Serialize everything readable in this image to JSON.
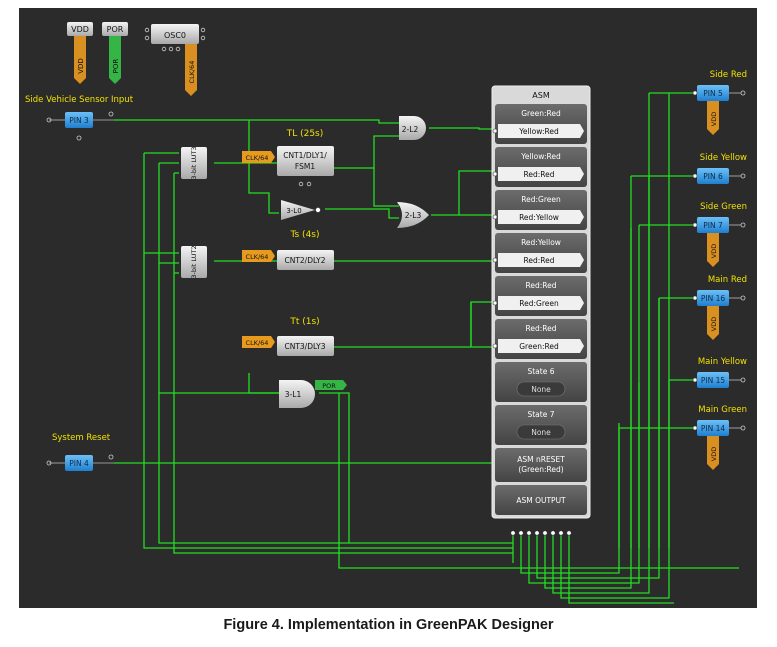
{
  "caption": "Figure 4. Implementation in GreenPAK Designer",
  "colors": {
    "background": "#2b2b2b",
    "wire": "#22dd22",
    "label_yellow": "#f2e200",
    "pin_blue": "#3aa0e6",
    "clk_orange": "#e89a1e",
    "vdd_tag": "#d99020",
    "por_tag": "#35b545"
  },
  "top_blocks": {
    "vdd": "VDD",
    "por": "POR",
    "osc": "OSC0",
    "clk_tag": "CLK/64"
  },
  "input_pins": [
    {
      "label": "Side Vehicle Sensor Input",
      "pin": "PIN 3"
    },
    {
      "label": "System Reset",
      "pin": "PIN 4"
    }
  ],
  "output_pins": [
    {
      "label": "Side Red",
      "pin": "PIN 5",
      "vdd": true
    },
    {
      "label": "Side Yellow",
      "pin": "PIN 6",
      "vdd": false
    },
    {
      "label": "Side Green",
      "pin": "PIN 7",
      "vdd": true
    },
    {
      "label": "Main Red",
      "pin": "PIN 16",
      "vdd": true
    },
    {
      "label": "Main Yellow",
      "pin": "PIN 15",
      "vdd": false
    },
    {
      "label": "Main Green",
      "pin": "PIN 14",
      "vdd": true
    }
  ],
  "vdd_tag": "VDD",
  "luts": [
    "3-bit LUT3",
    "3-bit LUT2"
  ],
  "counters": [
    {
      "title": "TL (25s)",
      "name": "CNT1/DLY1/ FSM1",
      "clk": "CLK/64"
    },
    {
      "title": "Ts (4s)",
      "name": "CNT2/DLY2",
      "clk": "CLK/64"
    },
    {
      "title": "Tt (1s)",
      "name": "CNT3/DLY3",
      "clk": "CLK/64"
    }
  ],
  "gates": {
    "and2": "2-L2",
    "inv": "3-L0",
    "or2": "2-L3",
    "and3": "3-L1",
    "por_tag": "POR"
  },
  "asm": {
    "title": "ASM",
    "states": [
      {
        "top": "Green:Red",
        "bottom": "Yellow:Red"
      },
      {
        "top": "Yellow:Red",
        "bottom": "Red:Red"
      },
      {
        "top": "Red:Green",
        "bottom": "Red:Yellow"
      },
      {
        "top": "Red:Yellow",
        "bottom": "Red:Red"
      },
      {
        "top": "Red:Red",
        "bottom": "Red:Green"
      },
      {
        "top": "Red:Red",
        "bottom": "Green:Red"
      }
    ],
    "empty_states": [
      {
        "name": "State 6",
        "value": "None"
      },
      {
        "name": "State 7",
        "value": "None"
      }
    ],
    "reset_line1": "ASM nRESET",
    "reset_line2": "(Green:Red)",
    "output": "ASM OUTPUT"
  }
}
